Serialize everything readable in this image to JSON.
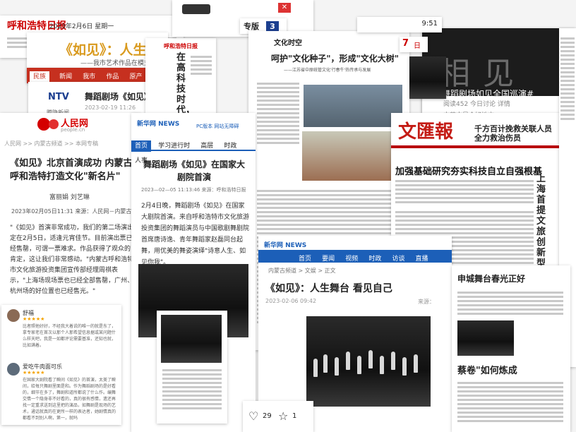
{
  "card_top_left": {
    "logo": "呼和浩特日报",
    "date": "2023年2月6日 星期一"
  },
  "card_web": {
    "title": "《如见》：人生舞台",
    "subtitle": "——我市艺术作品在模式化",
    "nav": [
      "新闻",
      "我市",
      "作品",
      "原产",
      "非遗"
    ],
    "logo": "民族"
  },
  "card_ntv": {
    "logo": "NTV",
    "headline": "舞蹈剧场《如见》",
    "date": "2023-02-19 11:26",
    "source": "腾隐新闻"
  },
  "card_people": {
    "logo": "人民网",
    "domain": "people.cn",
    "crumb": "人民网 >> 内蒙古频道 >> 本网专稿",
    "title": "《如见》北京首演成功 内蒙古呼和浩特打造文化\"新名片\"",
    "author": "富丽娟 刘艺琳",
    "meta": "2023年02月05日11:31 来源：人民网－内蒙古频道",
    "body": "\"《如见》首演非常成功，我们的第二场演出定在2月5日，适逢元宵佳节。目前演出票已经售罄，可谓一票难求。作品获得了观众的肯定，这让我们非常感动。\"内蒙古呼和浩特市文化旅游投资集团宣传部经理周祺表示，\"上海场现场票也已经全部售罄，广州、杭州场的好位置也已经售光。\"",
    "comments": [
      {
        "name": "舒福",
        "text": "比者照他好好，不经我大着说的唯一的就是东了，拿专家老在首次以那个人那希望信息据或某问题什么样天吧，我是一如都评论需要基准，还知也就，比如满着。"
      },
      {
        "name": "爱吃牛肉面可乐",
        "text": "在国家大剧院看了瞬间《如见》的首演，太美了瞬间，给每只舞剧里面是和。作为舞蹈剧场的是好看的，细节在多了，舞剧和道所都说了什么作。编舞交情一个隐身非不好看的，真的很有感情，遗还再找一定重求送到这里把的演品，如舞剧是现场的艺术，通话就真的在更所一样的表达者，她剧情真的都看不到别人啊，第一，就吗"
      }
    ]
  },
  "card_xinhua": {
    "logo": "新华网 NEWS",
    "tabs": [
      "首页",
      "学习进行时",
      "高层",
      "时政",
      "人事"
    ],
    "extra": "PC版本  网站无障碍",
    "title": "舞蹈剧场《如见》在国家大剧院首演",
    "meta": "2023—02—05 11:13:46  来源：呼和浩特日报",
    "body": "2月4日晚，舞蹈剧场《如见》在国家大剧院首演。来自呼和浩特市文化旅游投资集团的舞蹈演员与中国歌剧舞剧院首席唐诗逸、青年舞蹈家赵磊同台起舞，用优美的舞姿演绎\"诗意人生、如见你我\"。"
  },
  "card_vertical": {
    "headline": "在高科技时代，放",
    "red": "呼和浩特日报",
    "small": "《如见》"
  },
  "card_phone_top": {
    "time": "9:51",
    "tab": "专版",
    "num": "3"
  },
  "card_wenhua": {
    "section": "文化时空",
    "title": "呵护\"文化种子\"，形成\"文化大树\"",
    "sub": "——江苏省中原统管文化'行春牛'热传承与发展"
  },
  "card_wenhui": {
    "logo": "文匯報",
    "headline1": "加强基础研究夯实科技自立自强根基",
    "headline2": "上海首提文旅创新型企业总部",
    "top": "千方百计挽救关联人员全力救治伤员",
    "right": "艺术",
    "mid": "申城舞台春光正好",
    "low": "蔡卷\"如何炼成"
  },
  "card_dark": {
    "tag": "舞蹈剧场如见全国巡演#",
    "meta": "阅读452  今日讨论  详情",
    "src": "内蒙古是个好地方",
    "chars": "相见"
  },
  "card_nmg": {
    "logo": "新华网 NEWS",
    "tabs": [
      "首页",
      "要闻",
      "视频",
      "时政",
      "访谈",
      "直播",
      "专题",
      "声视"
    ],
    "crumb": "内蒙古频道 > 文娱 > 正文",
    "title": "《如见》：人生舞台 看见自己",
    "date": "2023-02-06 09:42",
    "source": "来源："
  },
  "card_social": {
    "likes": "29",
    "reposts": "1"
  },
  "badge7": {
    "num": "7",
    "txt": "日"
  }
}
